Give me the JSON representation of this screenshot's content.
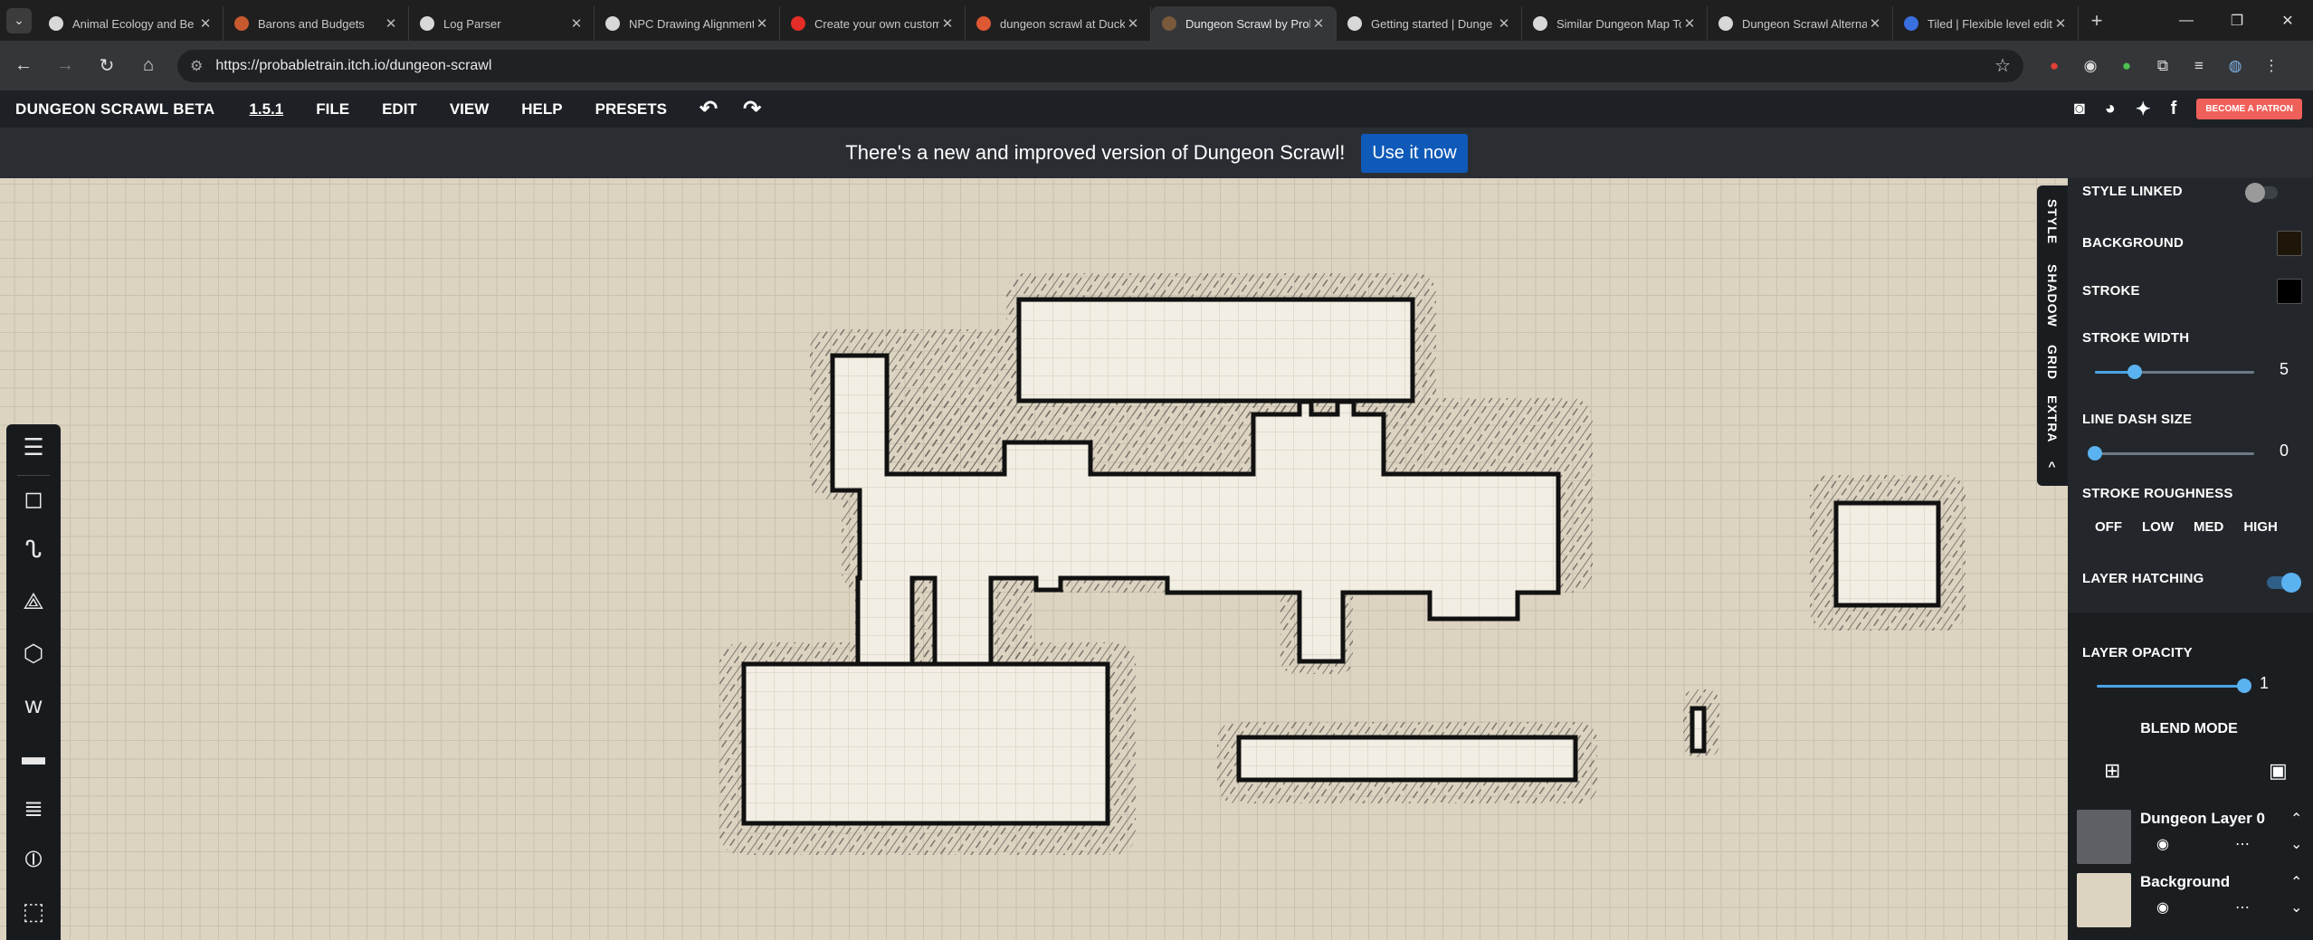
{
  "browser": {
    "tabs": [
      {
        "title": "Animal Ecology and Be",
        "icon": "openai-icon",
        "color": "#d8d8d8"
      },
      {
        "title": "Barons and Budgets",
        "icon": "fox-icon",
        "color": "#c65a2e"
      },
      {
        "title": "Log Parser",
        "icon": "openai-icon",
        "color": "#d8d8d8"
      },
      {
        "title": "NPC Drawing Alignment",
        "icon": "openai-icon",
        "color": "#d8d8d8"
      },
      {
        "title": "Create your own custom",
        "icon": "youtube-icon",
        "color": "#e52d27"
      },
      {
        "title": "dungeon scrawl at Duck",
        "icon": "duckduckgo-icon",
        "color": "#de5833"
      },
      {
        "title": "Dungeon Scrawl by Prob",
        "icon": "itch-icon",
        "color": "#7a5a3a",
        "active": true
      },
      {
        "title": "Getting started | Dunge",
        "icon": "openai-icon",
        "color": "#d8d8d8"
      },
      {
        "title": "Similar Dungeon Map To",
        "icon": "openai-icon",
        "color": "#d8d8d8"
      },
      {
        "title": "Dungeon Scrawl Alterna",
        "icon": "openai-icon",
        "color": "#d8d8d8"
      },
      {
        "title": "Tiled | Flexible level edit",
        "icon": "tiled-icon",
        "color": "#3a6fe0"
      }
    ],
    "url": "https://probabletrain.itch.io/dungeon-scrawl"
  },
  "app": {
    "title": "DUNGEON SCRAWL BETA",
    "version": "1.5.1",
    "menu": [
      "FILE",
      "EDIT",
      "VIEW",
      "HELP",
      "PRESETS"
    ],
    "patron_label": "BECOME A PATRON"
  },
  "notice": {
    "text": "There's a new and improved version of Dungeon Scrawl!",
    "button": "Use it now"
  },
  "side_tabs": [
    "STYLE",
    "SHADOW",
    "GRID",
    "EXTRA",
    "^"
  ],
  "style_panel": {
    "style_linked": "STYLE LINKED",
    "style_linked_on": false,
    "background_label": "BACKGROUND",
    "background_color": "#1e1608",
    "stroke_label": "STROKE",
    "stroke_color": "#000000",
    "stroke_width_label": "STROKE WIDTH",
    "stroke_width": "5",
    "stroke_width_fraction": 0.25,
    "line_dash_label": "LINE DASH SIZE",
    "line_dash": "0",
    "line_dash_fraction": 0,
    "roughness_label": "STROKE ROUGHNESS",
    "roughness_options": [
      "OFF",
      "LOW",
      "MED",
      "HIGH"
    ],
    "hatching_label": "LAYER HATCHING",
    "hatching_on": true
  },
  "layers_panel": {
    "opacity_label": "LAYER OPACITY",
    "opacity": "1",
    "opacity_fraction": 1,
    "blend_mode": "BLEND MODE",
    "layers": [
      {
        "name": "Dungeon Layer 0",
        "thumb": "#5d6166"
      },
      {
        "name": "Background",
        "thumb": "#dcd4c1"
      }
    ]
  }
}
